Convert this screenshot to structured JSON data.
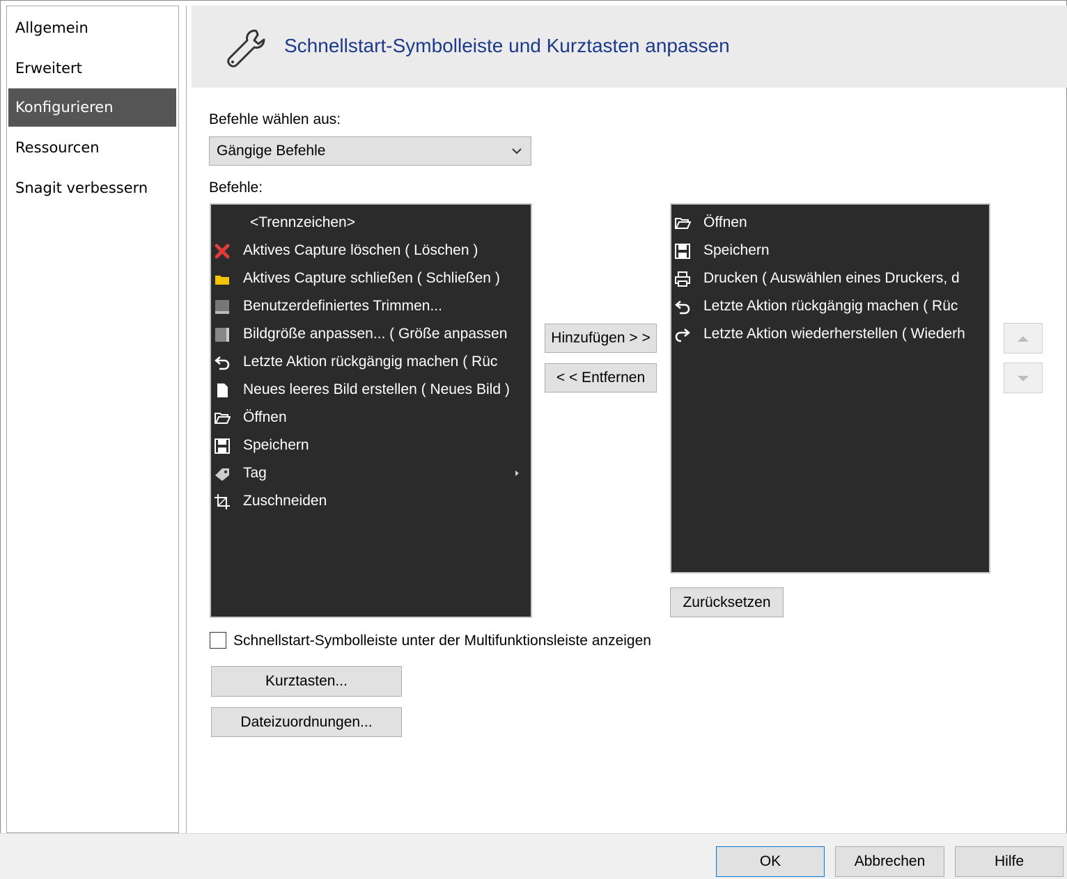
{
  "sidebar": {
    "items": [
      {
        "label": "Allgemein"
      },
      {
        "label": "Erweitert"
      },
      {
        "label": "Konfigurieren"
      },
      {
        "label": "Ressourcen"
      },
      {
        "label": "Snagit verbessern"
      }
    ],
    "active_index": 2
  },
  "header": {
    "title": "Schnellstart-Symbolleiste und Kurztasten anpassen",
    "icon": "wrench-icon"
  },
  "commands_from": {
    "label": "Befehle wählen aus:",
    "selected": "Gängige Befehle"
  },
  "commands": {
    "label": "Befehle:",
    "items": [
      {
        "text": "<Trennzeichen>",
        "icon": ""
      },
      {
        "text": "Aktives Capture löschen ( Löschen )",
        "icon": "delete-x-icon"
      },
      {
        "text": "Aktives Capture schließen ( Schließen )",
        "icon": "folder-icon"
      },
      {
        "text": "Benutzerdefiniertes Trimmen...",
        "icon": "trim-icon"
      },
      {
        "text": "Bildgröße anpassen... ( Größe anpassen",
        "icon": "resize-icon"
      },
      {
        "text": "Letzte Aktion rückgängig machen ( Rüc",
        "icon": "undo-icon"
      },
      {
        "text": "Neues leeres Bild erstellen ( Neues Bild )",
        "icon": "new-document-icon"
      },
      {
        "text": "Öffnen",
        "icon": "open-folder-icon"
      },
      {
        "text": "Speichern",
        "icon": "save-icon"
      },
      {
        "text": "Tag",
        "icon": "tag-icon"
      },
      {
        "text": "Zuschneiden",
        "icon": "crop-icon"
      }
    ]
  },
  "toolbar_list": {
    "items": [
      {
        "text": "Öffnen",
        "icon": "open-folder-icon"
      },
      {
        "text": "Speichern",
        "icon": "save-icon"
      },
      {
        "text": "Drucken ( Auswählen eines Druckers, d",
        "icon": "print-icon"
      },
      {
        "text": "Letzte Aktion rückgängig machen ( Rüc",
        "icon": "undo-icon"
      },
      {
        "text": "Letzte Aktion wiederherstellen ( Wiederh",
        "icon": "redo-icon"
      }
    ]
  },
  "buttons": {
    "add": "Hinzufügen > >",
    "remove": "< < Entfernen",
    "reset": "Zurücksetzen",
    "shortcuts": "Kurztasten...",
    "file_assoc": "Dateizuordnungen...",
    "ok": "OK",
    "cancel": "Abbrechen",
    "help": "Hilfe"
  },
  "checkbox": {
    "label": "Schnellstart-Symbolleiste unter der Multifunktionsleiste anzeigen",
    "checked": false
  },
  "colors": {
    "accent_title": "#1d3a8a",
    "list_bg": "#2b2b2b",
    "sidebar_active": "#555555"
  }
}
